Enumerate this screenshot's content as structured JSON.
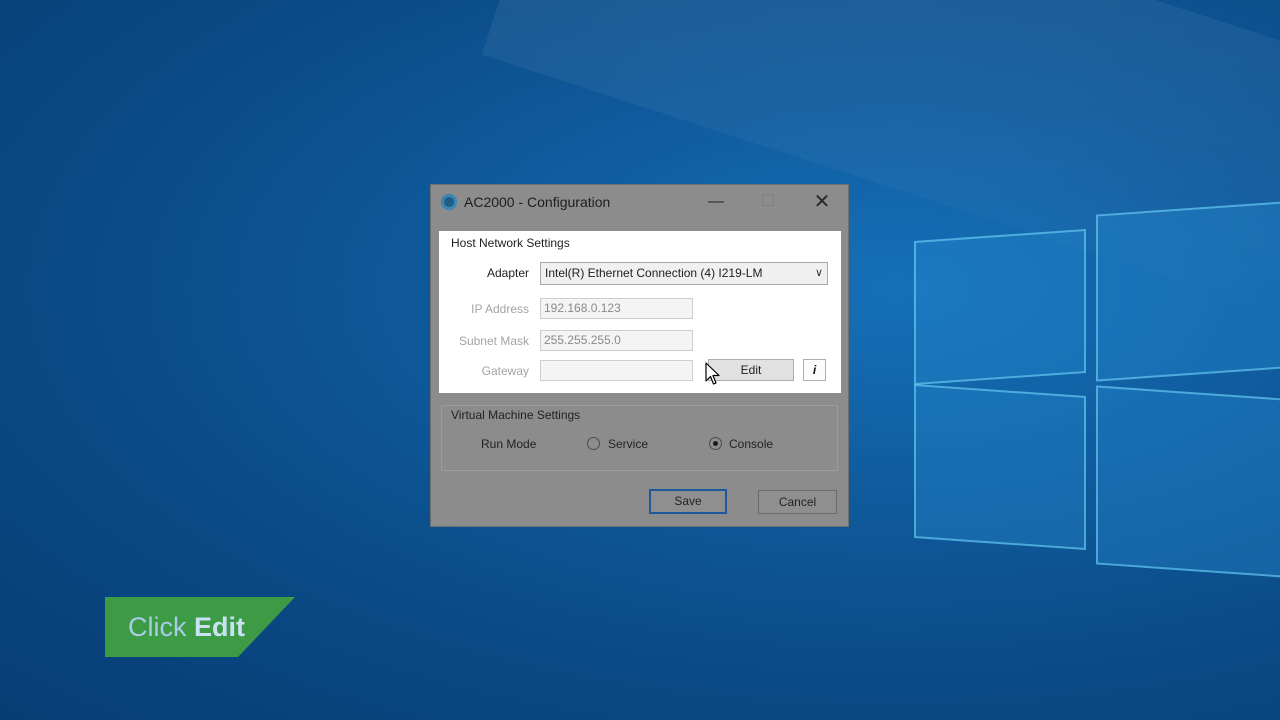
{
  "dialog": {
    "title": "AC2000 - Configuration",
    "host_group_label": "Host Network Settings",
    "adapter": {
      "label": "Adapter",
      "value": "Intel(R) Ethernet Connection (4) I219-LM"
    },
    "ip_address": {
      "label": "IP Address",
      "value": "192.168.0.123"
    },
    "subnet_mask": {
      "label": "Subnet Mask",
      "value": "255.255.255.0"
    },
    "gateway": {
      "label": "Gateway",
      "value": ""
    },
    "edit_button": "Edit",
    "info_button": "i",
    "vm_group_label": "Virtual Machine Settings",
    "run_mode": {
      "label": "Run Mode",
      "options": [
        "Service",
        "Console"
      ],
      "selected": "Console"
    },
    "save_button": "Save",
    "cancel_button": "Cancel"
  },
  "caption": {
    "prefix": "Click",
    "action": "Edit"
  },
  "colors": {
    "caption_bg": "#3d9a45",
    "desktop_bg": "#0f5a9c",
    "dialog_dim": "#8c8c8c"
  }
}
